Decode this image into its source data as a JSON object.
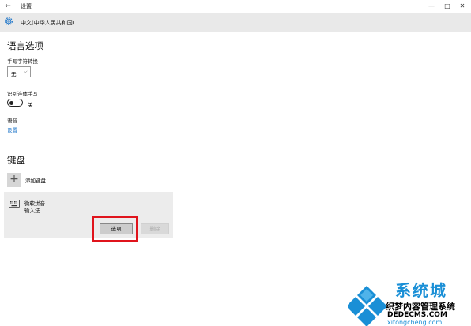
{
  "window": {
    "title": "设置",
    "controls": {
      "minimize": "—",
      "maximize": "□",
      "close": "✕"
    }
  },
  "header": {
    "title": "中文(中华人民共和国)"
  },
  "language_options": {
    "heading": "语言选项",
    "handwriting": {
      "label": "手写字符转换",
      "selected": "无",
      "icon": "chevron-down-icon"
    },
    "recognize_cursive": {
      "label": "识别连体手写",
      "state": "关",
      "on": false
    },
    "speech": {
      "label": "语音",
      "link": "设置"
    }
  },
  "keyboard": {
    "heading": "键盘",
    "add_label": "添加键盘",
    "item": {
      "name": "微软拼音",
      "type": "输入法",
      "icon": "keyboard-icon"
    },
    "buttons": {
      "options": "选项",
      "delete": "删除"
    }
  },
  "watermark": {
    "brand": "系统城",
    "line2": "织梦内容管理系统",
    "line3": "DEDECMS.COM",
    "line4": "xitongcheng.com"
  },
  "colors": {
    "accent": "#1a73c8",
    "highlight": "#e0141c",
    "header_bg": "#e9e9e9"
  }
}
